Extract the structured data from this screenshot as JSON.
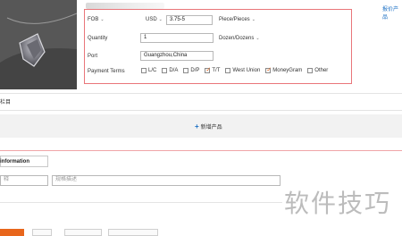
{
  "header": {
    "right_link": "报价产品"
  },
  "price_row": {
    "terms_select": "FOB",
    "currency_select": "USD",
    "price_value": "3.75-5",
    "unit_select": "Piece/Pieces"
  },
  "quantity_row": {
    "label": "Quantity",
    "value": "1",
    "unit_select": "Dozen/Dozens"
  },
  "port_row": {
    "label": "Port",
    "value": "Guangzhou,China"
  },
  "payment_row": {
    "label": "Payment Terms",
    "options": [
      {
        "label": "L/C",
        "checked": false
      },
      {
        "label": "D/A",
        "checked": false
      },
      {
        "label": "D/P",
        "checked": false
      },
      {
        "label": "T/T",
        "checked": true
      },
      {
        "label": "West Union",
        "checked": false
      },
      {
        "label": "MoneyGram",
        "checked": true
      },
      {
        "label": "Other",
        "checked": false
      }
    ]
  },
  "section": {
    "title": "栏目"
  },
  "add_product": {
    "label": "新增产品"
  },
  "info": {
    "title": "information",
    "input1_placeholder": "释",
    "input2_placeholder": "规格描述"
  },
  "watermark": "软件技巧",
  "colors": {
    "accent": "#e8661c",
    "border_red": "#e9767a",
    "link": "#1a6fc4"
  }
}
